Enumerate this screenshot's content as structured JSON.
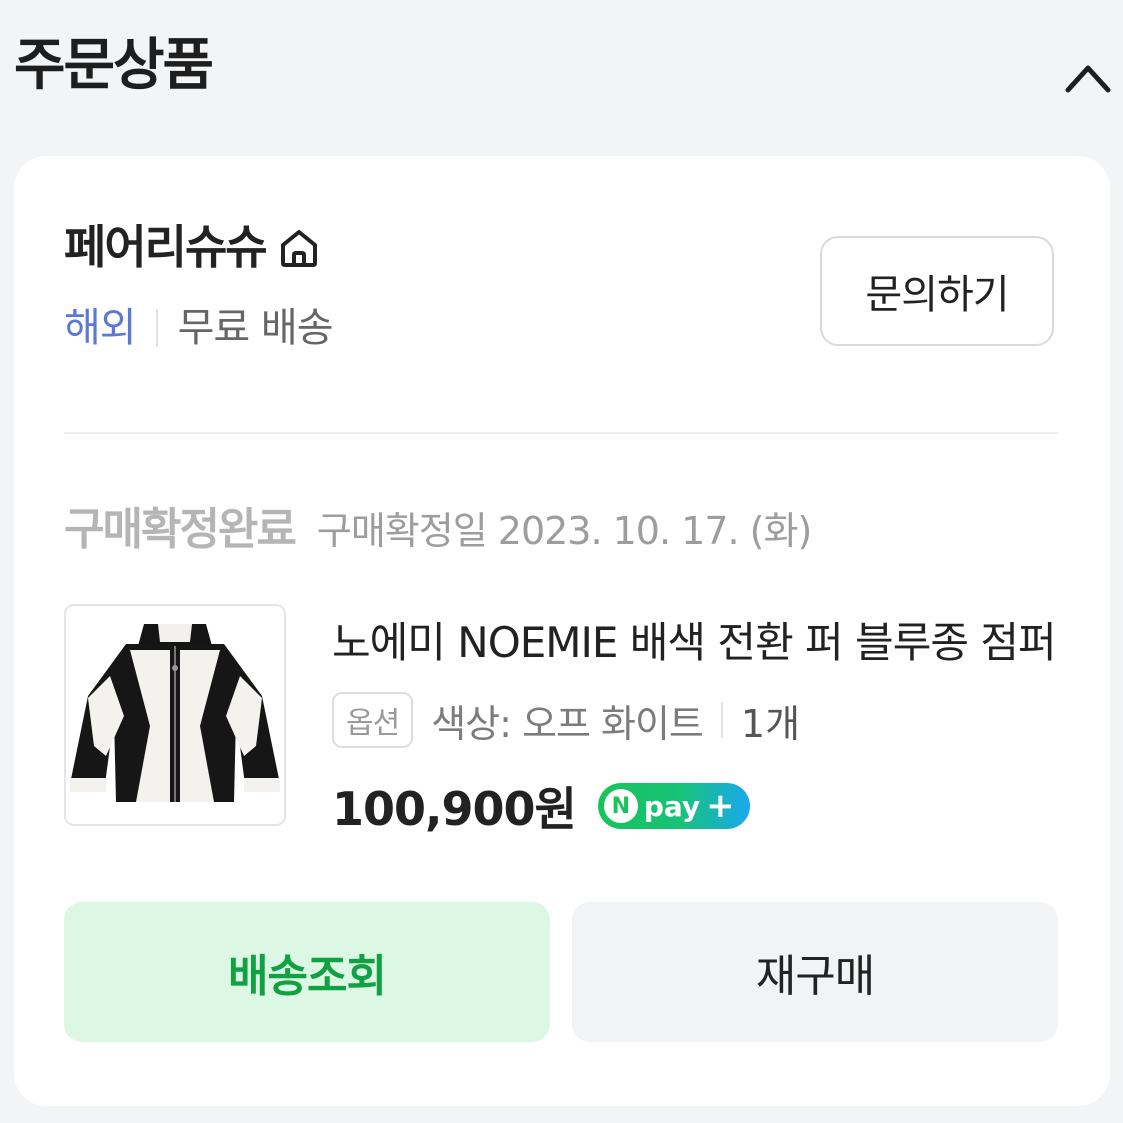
{
  "header": {
    "title": "주문상품",
    "collapse_icon": "chevron-up-icon"
  },
  "seller": {
    "name": "페어리슈슈",
    "home_icon": "home-icon",
    "tag_overseas": "해외",
    "shipping": "무료 배송",
    "inquiry_label": "문의하기"
  },
  "order": {
    "status": "구매확정완료",
    "confirm_date": "구매확정일 2023. 10. 17. (화)"
  },
  "product": {
    "title": "노에미 NOEMIE 배색 전환 퍼 블루종 점퍼",
    "option_badge": "옵션",
    "option_value": "색상: 오프 화이트",
    "quantity": "1개",
    "price": "100,900원",
    "npay_label": "pay"
  },
  "actions": {
    "track_label": "배송조회",
    "rebuy_label": "재구매"
  },
  "colors": {
    "page_bg": "#f2f4f6",
    "overseas_blue": "#5a78d6",
    "track_green": "#12a142",
    "track_bg": "#dcf7e4",
    "npay_green": "#19c35a"
  }
}
